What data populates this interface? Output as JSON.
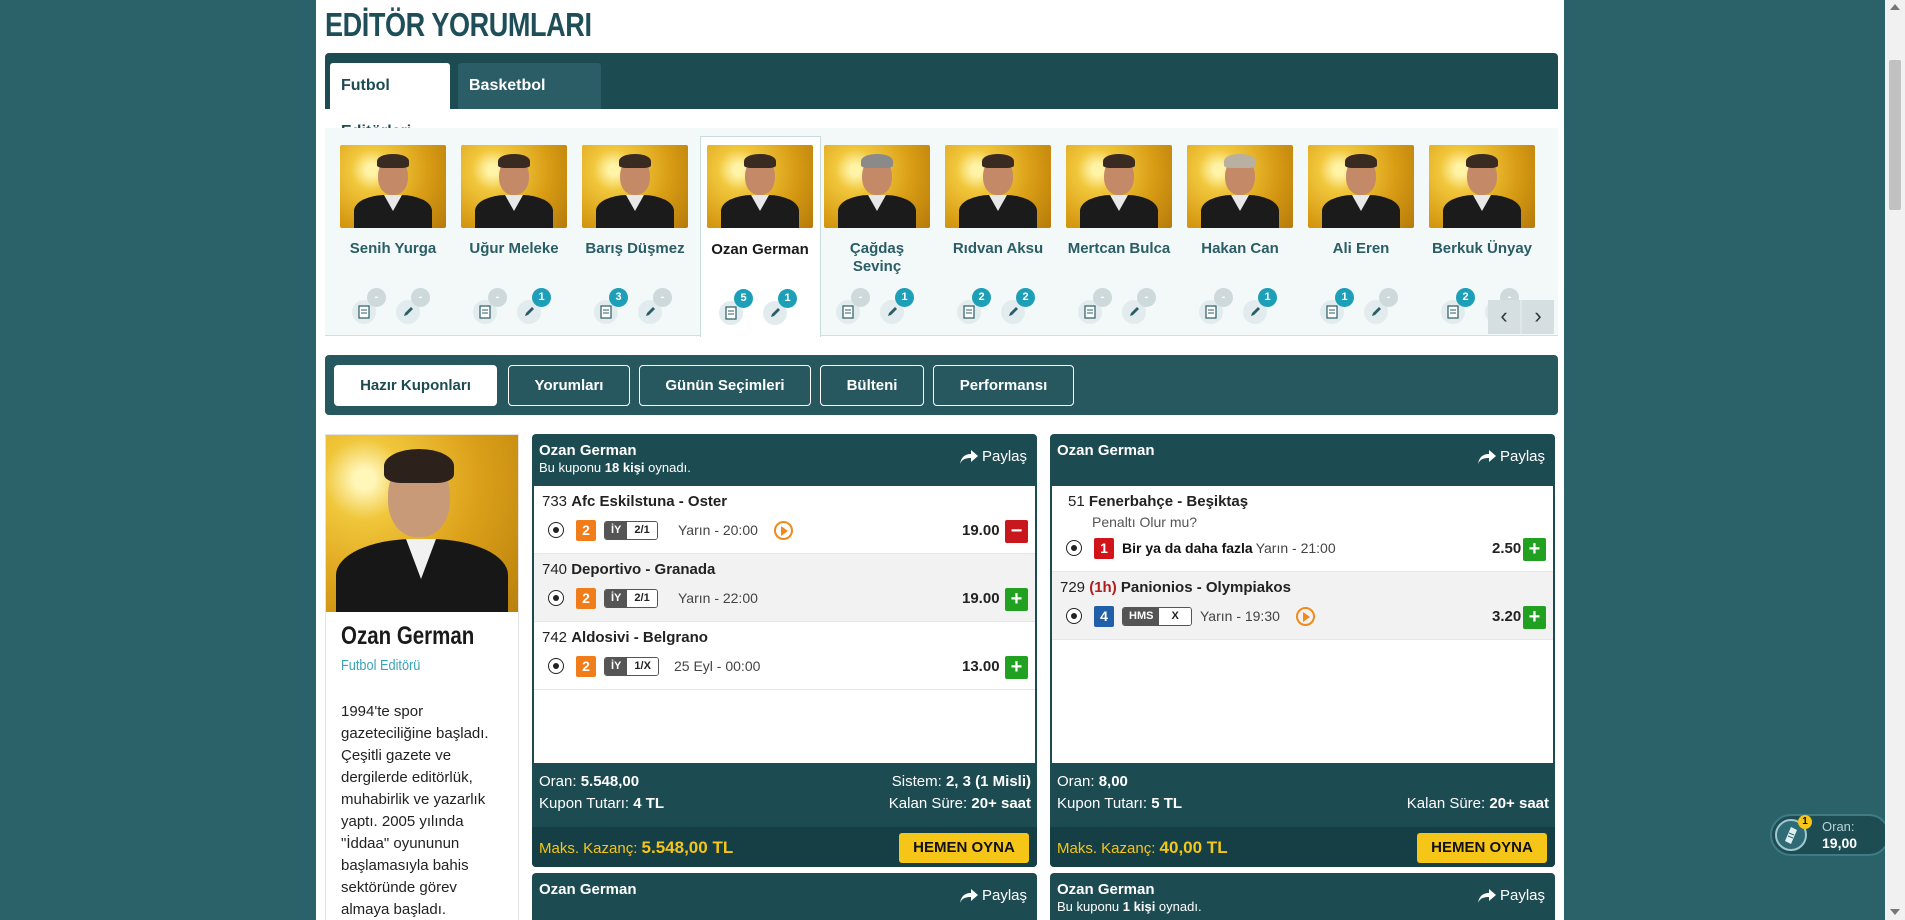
{
  "page_title": "EDİTÖR YORUMLARI",
  "tabs": [
    {
      "label": "Futbol Editörleri",
      "active": true
    },
    {
      "label": "Basketbol Editörleri",
      "active": false
    }
  ],
  "editors": [
    {
      "name": "Senih Yurga",
      "coupons": "-",
      "comments": "-"
    },
    {
      "name": "Uğur Meleke",
      "coupons": "-",
      "comments": "1"
    },
    {
      "name": "Barış Düşmez",
      "coupons": "3",
      "comments": "-"
    },
    {
      "name": "Ozan German",
      "coupons": "5",
      "comments": "1",
      "active": true
    },
    {
      "name": "Çağdaş Sevinç",
      "coupons": "-",
      "comments": "1"
    },
    {
      "name": "Rıdvan Aksu",
      "coupons": "2",
      "comments": "2"
    },
    {
      "name": "Mertcan Bulca",
      "coupons": "-",
      "comments": "-"
    },
    {
      "name": "Hakan Can",
      "coupons": "-",
      "comments": "1"
    },
    {
      "name": "Ali Eren",
      "coupons": "1",
      "comments": "-"
    },
    {
      "name": "Berkuk Ünyay",
      "coupons": "2",
      "comments": "-"
    }
  ],
  "strip_arrows": {
    "prev": "‹",
    "next": "›"
  },
  "subnav": [
    "Hazır Kuponları",
    "Yorumları",
    "Günün Seçimleri",
    "Bülteni",
    "Performansı"
  ],
  "profile": {
    "name": "Ozan German",
    "role": "Futbol Editörü",
    "bio": "1994'te spor gazeteciliğine başladı. Çeşitli gazete ve dergilerde editörlük, muhabirlik ve yazarlık yaptı. 2005 yılında \"İddaa\" oyununun başlamasıyla bahis sektöründe görev almaya başladı."
  },
  "share_label": "Paylaş",
  "play_label": "HEMEN OYNA",
  "coupons": [
    {
      "editor": "Ozan German",
      "played_prefix": "Bu kuponu ",
      "played_count": "18 kişi",
      "played_suffix": " oynadı.",
      "matches": [
        {
          "code": "733",
          "teams": "Afc Eskilstuna - Oster",
          "mbs": "2",
          "bet_type": "İY",
          "bet_value": "2/1",
          "time": "Yarın - 20:00",
          "live": true,
          "odd": "19.00",
          "action": "−"
        },
        {
          "code": "740",
          "teams": "Deportivo - Granada",
          "mbs": "2",
          "bet_type": "İY",
          "bet_value": "2/1",
          "time": "Yarın - 22:00",
          "live": false,
          "odd": "19.00",
          "action": "+"
        },
        {
          "code": "742",
          "teams": "Aldosivi - Belgrano",
          "mbs": "2",
          "bet_type": "İY",
          "bet_value": "1/X",
          "time": "25 Eyl - 00:00",
          "live": false,
          "odd": "13.00",
          "action": "+"
        }
      ],
      "odds_label": "Oran:",
      "odds": "5.548,00",
      "system_label": "Sistem:",
      "system": "2, 3 (1 Misli)",
      "stake_label": "Kupon Tutarı:",
      "stake": "4 TL",
      "remaining_label": "Kalan Süre:",
      "remaining": "20+ saat",
      "max_win_label": "Maks. Kazanç:",
      "max_win": "5.548,00 TL"
    },
    {
      "editor": "Ozan German",
      "matches": [
        {
          "code": "51",
          "teams": "Fenerbahçe - Beşiktaş",
          "note": "Penaltı Olur mu?",
          "mbs": "1",
          "pick": "Bir ya da daha fazla",
          "time": "Yarın - 21:00",
          "odd": "2.50",
          "action": "+"
        },
        {
          "code": "729",
          "half": "(1h)",
          "teams": "Panionios - Olympiakos",
          "mbs": "4",
          "bet_type": "HMS",
          "bet_value": "X",
          "time": "Yarın - 19:30",
          "live": true,
          "odd": "3.20",
          "action": "+"
        }
      ],
      "odds_label": "Oran:",
      "odds": "8,00",
      "stake_label": "Kupon Tutarı:",
      "stake": "5 TL",
      "remaining_label": "Kalan Süre:",
      "remaining": "20+ saat",
      "max_win_label": "Maks. Kazanç:",
      "max_win": "40,00 TL"
    },
    {
      "editor": "Ozan German"
    },
    {
      "editor": "Ozan German",
      "played_prefix": "Bu kuponu ",
      "played_count": "1 kişi",
      "played_suffix": " oynadı."
    }
  ],
  "oran_widget": {
    "count": "1",
    "label": "Oran:",
    "value": "19,00"
  },
  "colors": {
    "header": "#1d4b52",
    "background": "#2b6269",
    "accent": "#f5c518",
    "plus": "#21a021",
    "minus": "#c8181e"
  }
}
